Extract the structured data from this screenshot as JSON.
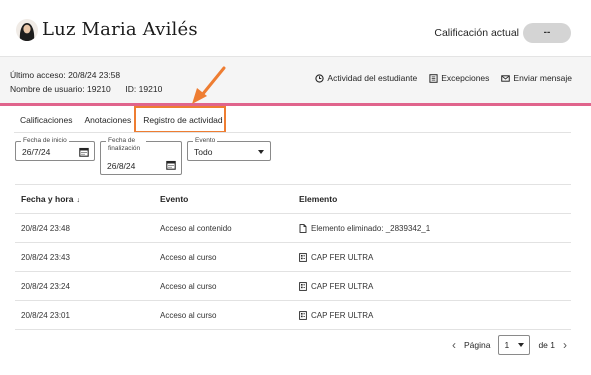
{
  "header": {
    "student_name": "Luz Maria Avilés",
    "grade_label": "Calificación actual",
    "grade_value": "--"
  },
  "info": {
    "last_access_label": "Último acceso:",
    "last_access_value": "20/8/24 23:58",
    "username_label": "Nombre de usuario:",
    "username_value": "19210",
    "id_label": "ID:",
    "id_value": "19210"
  },
  "actions": {
    "student_activity": "Actividad del estudiante",
    "exceptions": "Excepciones",
    "send_message": "Enviar mensaje"
  },
  "tabs": [
    {
      "label": "Calificaciones"
    },
    {
      "label": "Anotaciones"
    },
    {
      "label": "Registro de actividad"
    }
  ],
  "filters": {
    "start_label": "Fecha de inicio",
    "start_value": "26/7/24",
    "end_label": "Fecha de finalización",
    "end_value": "26/8/24",
    "event_label": "Evento",
    "event_value": "Todo"
  },
  "table": {
    "headers": [
      "Fecha y hora",
      "Evento",
      "Elemento"
    ],
    "sort_indicator": "↓",
    "rows": [
      {
        "date": "20/8/24 23:48",
        "event": "Acceso al contenido",
        "element": "Elemento eliminado: _2839342_1",
        "icon": "document-icon"
      },
      {
        "date": "20/8/24 23:43",
        "event": "Acceso al curso",
        "element": "CAP FER ULTRA",
        "icon": "course-icon"
      },
      {
        "date": "20/8/24 23:24",
        "event": "Acceso al curso",
        "element": "CAP FER ULTRA",
        "icon": "course-icon"
      },
      {
        "date": "20/8/24 23:01",
        "event": "Acceso al curso",
        "element": "CAP FER ULTRA",
        "icon": "course-icon"
      }
    ]
  },
  "pagination": {
    "page_label": "Página",
    "page_value": "1",
    "of_label": "de 1"
  },
  "colors": {
    "accent_pink": "#e0648c",
    "highlight_orange": "#ee7d32"
  }
}
